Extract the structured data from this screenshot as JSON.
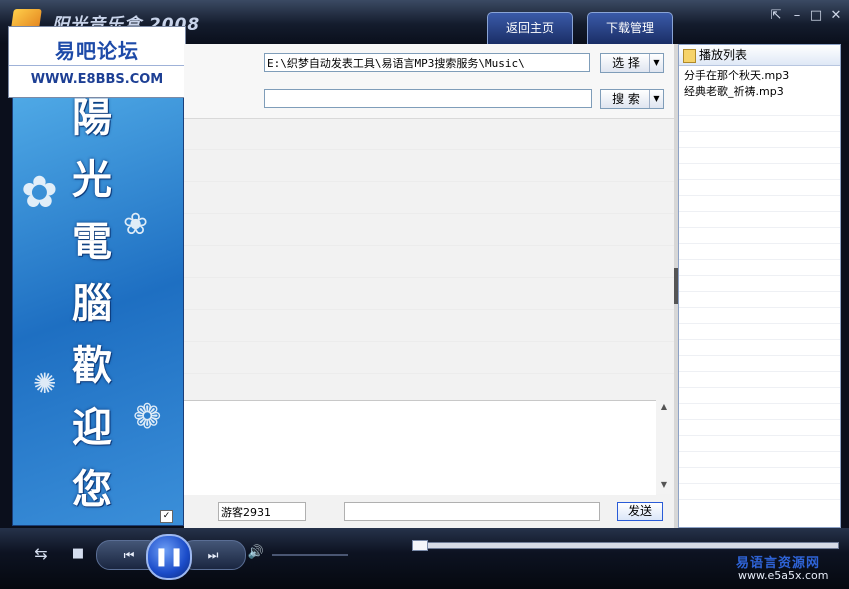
{
  "titlebar": {
    "title": "阳光音乐盒 2008",
    "tabs": [
      {
        "label": "返回主页"
      },
      {
        "label": "下载管理"
      }
    ],
    "window_buttons": {
      "restore": "⇱",
      "minimize": "–",
      "maximize": "□",
      "close": "✕"
    }
  },
  "banner": {
    "name": "易吧论坛",
    "url": "WWW.E8BBS.COM"
  },
  "sidebar": {
    "welcome_chars": [
      "陽",
      "光",
      "電",
      "腦",
      "歡",
      "迎",
      "您"
    ],
    "checkbox": "✓"
  },
  "toolbar": {
    "path_value": "E:\\织梦自动发表工具\\易语言MP3搜索服务\\Music\\",
    "search_value": "",
    "choose_label": "选 择",
    "search_label": "搜 索",
    "dropdown_arrow": "▼"
  },
  "chat": {
    "username": "游客2931",
    "message_value": "",
    "send_label": "发送",
    "scroll_up": "▲",
    "scroll_down": "▼"
  },
  "playlist": {
    "title": "播放列表",
    "items": [
      {
        "label": "分手在那个秋天.mp3"
      },
      {
        "label": "经典老歌_祈祷.mp3"
      }
    ]
  },
  "player": {
    "shuffle_icon": "⇆",
    "stop_icon": "■",
    "prev_icon": "⏮",
    "pause_icon": "❚❚",
    "next_icon": "⏭",
    "volume_icon": "🔊",
    "progress_fraction": 0.0
  },
  "watermark": {
    "cn": "易语言资源网",
    "url": "www.e5a5x.com"
  },
  "colors": {
    "accent": "#1b4cc9",
    "sidebar_blue": "#2a7fd2"
  }
}
